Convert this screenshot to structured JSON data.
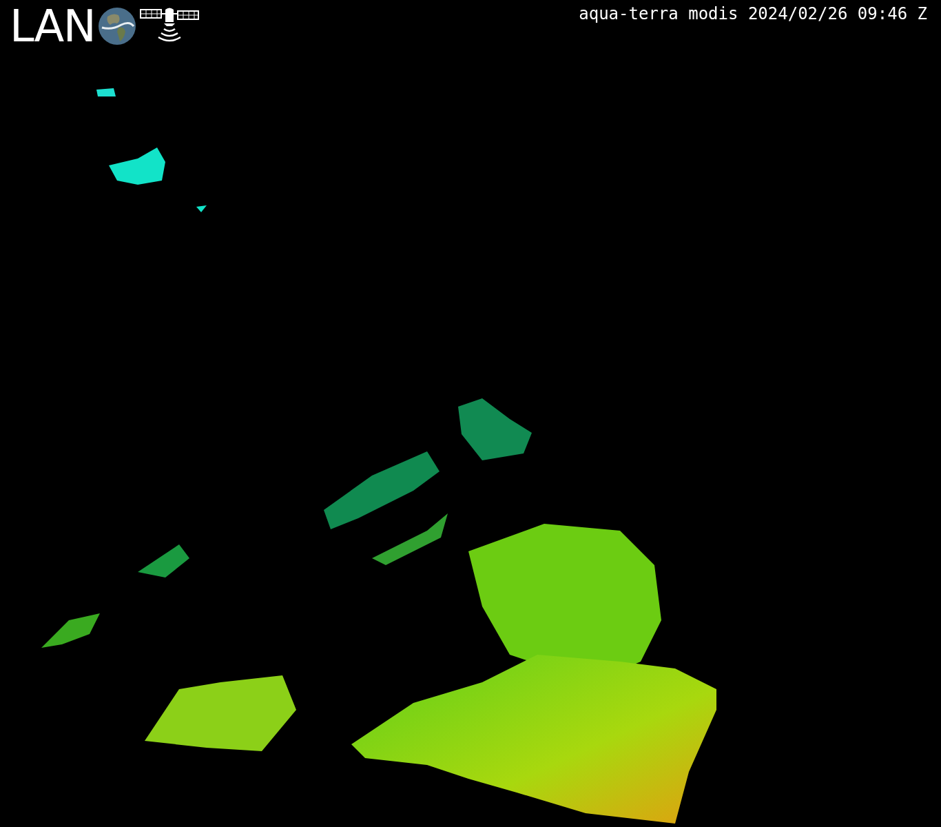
{
  "logo": {
    "text": "LAN"
  },
  "caption": "aqua-terra modis 2024/02/26 09:46 Z"
}
